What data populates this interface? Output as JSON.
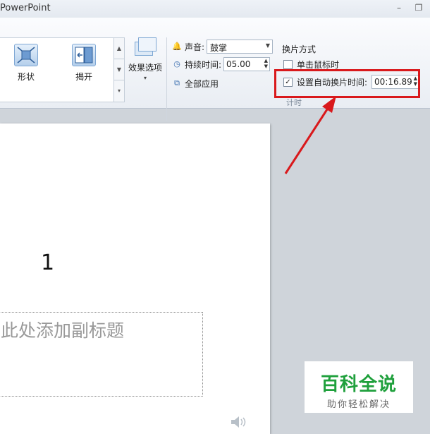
{
  "window": {
    "title": "PowerPoint",
    "minimize": "–",
    "restore": "❐"
  },
  "gallery": {
    "items": [
      {
        "label": "形状",
        "icon": "shape-transition-icon"
      },
      {
        "label": "揭开",
        "icon": "uncover-transition-icon"
      }
    ]
  },
  "effect_options": {
    "label": "效果选项",
    "arrow": "▾"
  },
  "timing": {
    "sound_label": "声音:",
    "sound_value": "鼓掌",
    "duration_label": "持续时间:",
    "duration_value": "05.00",
    "apply_all_label": "全部应用",
    "footer": "计时"
  },
  "advance": {
    "header": "换片方式",
    "on_click_label": "单击鼠标时",
    "on_click_checked": false,
    "after_label": "设置自动换片时间:",
    "after_checked": true,
    "after_value": "00:16.89",
    "check_mark": "✓"
  },
  "slide": {
    "number": "1",
    "subtitle_placeholder": "此处添加副标题"
  },
  "watermark": {
    "main": "百科全说",
    "sub": "助你轻松解决"
  },
  "colors": {
    "highlight": "#d9191c",
    "watermark_green": "#1fa03c"
  }
}
